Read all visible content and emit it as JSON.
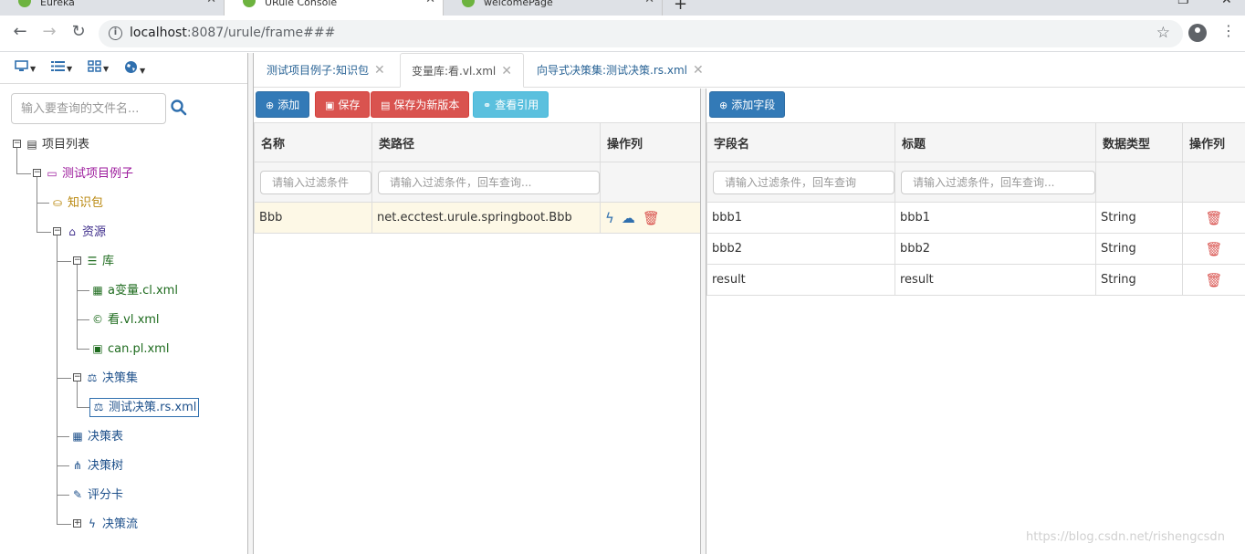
{
  "browser": {
    "tabs": [
      {
        "title": "Eureka",
        "active": false
      },
      {
        "title": "URule Console",
        "active": true
      },
      {
        "title": "welcomePage",
        "active": false
      }
    ],
    "url_host": "localhost",
    "url_path": ":8087/urule/frame###"
  },
  "sidebar": {
    "search_placeholder": "输入要查询的文件名...",
    "tree": {
      "root": "项目列表",
      "project": "测试项目例子",
      "knowledge": "知识包",
      "resources": "资源",
      "library": "库",
      "lib_items": [
        "a变量.cl.xml",
        "看.vl.xml",
        "can.pl.xml"
      ],
      "decision_set": "决策集",
      "decision_set_item": "测试决策.rs.xml",
      "decision_table": "决策表",
      "decision_tree": "决策树",
      "scorecard": "评分卡",
      "decision_flow": "决策流"
    }
  },
  "main_tabs": [
    {
      "label": "测试项目例子:知识包",
      "active": false
    },
    {
      "label": "变量库:看.vl.xml",
      "active": true
    },
    {
      "label": "向导式决策集:测试决策.rs.xml",
      "active": false
    }
  ],
  "left_pane": {
    "buttons": {
      "add": "添加",
      "save": "保存",
      "save_new": "保存为新版本",
      "view_refs": "查看引用"
    },
    "headers": [
      "名称",
      "类路径",
      "操作列"
    ],
    "filter_placeholders": [
      "请输入过滤条件",
      "请输入过滤条件，回车查询..."
    ],
    "rows": [
      {
        "name": "Bbb",
        "path": "net.ecctest.urule.springboot.Bbb"
      }
    ]
  },
  "right_pane": {
    "buttons": {
      "add_field": "添加字段"
    },
    "headers": [
      "字段名",
      "标题",
      "数据类型",
      "操作列"
    ],
    "filter_placeholders": [
      "请输入过滤条件，回车查询",
      "请输入过滤条件，回车查询..."
    ],
    "rows": [
      {
        "name": "bbb1",
        "title": "bbb1",
        "type": "String"
      },
      {
        "name": "bbb2",
        "title": "bbb2",
        "type": "String"
      },
      {
        "name": "result",
        "title": "result",
        "type": "String"
      }
    ]
  },
  "watermark": "https://blog.csdn.net/rishengcsdn"
}
